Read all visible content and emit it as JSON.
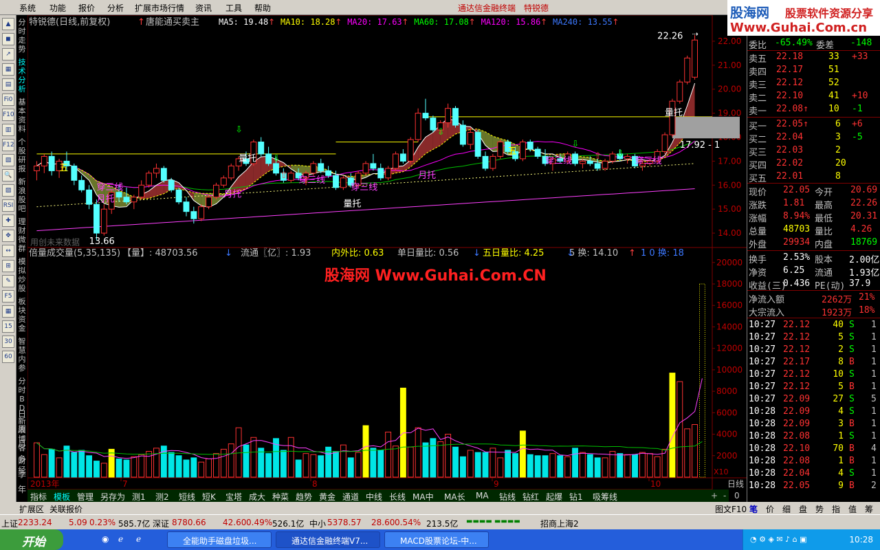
{
  "menu": {
    "items": [
      "系统",
      "功能",
      "报价",
      "分析",
      "扩展市场行情",
      "资讯",
      "工具",
      "帮助"
    ],
    "app_name": "通达信金融终端",
    "stock_name": "特锐德"
  },
  "logo": {
    "line1": "股海网",
    "line1b": "股票软件资源分享",
    "line2": "Www.Guhai.Com.cn"
  },
  "left_tabs": [
    "分时走势",
    "技术分析",
    "基本资料",
    "个股研报",
    "新浪股吧",
    "理财微群",
    "模拟炒股",
    "板块资金",
    "智慧内参",
    "分时BD",
    "新浪博客",
    "财经"
  ],
  "left_tabs_bottom": [
    "日",
    "周",
    "月",
    "多",
    "季",
    "年"
  ],
  "left_tools": [
    "▲",
    "◼",
    "↗",
    "▦",
    "▤",
    "Fi0",
    "F10",
    "▥",
    "F12",
    "▧",
    "🔍",
    "▨",
    "RSI",
    "✚",
    "✥",
    "↔",
    "⊞",
    "✎",
    "F5",
    "▦",
    "15",
    "30",
    "60"
  ],
  "chart": {
    "title": "特锐德(日线,前复权)",
    "indicator": "唐能通买卖主",
    "ma": [
      {
        "label": "MA5: 19.48",
        "color": "#ffffff"
      },
      {
        "label": "MA10: 18.28",
        "color": "#ffff00"
      },
      {
        "label": "MA20: 17.63",
        "color": "#ff00ff"
      },
      {
        "label": "MA60: 17.08",
        "color": "#00ff00"
      },
      {
        "label": "MA120: 15.86",
        "color": "#ff00ff"
      },
      {
        "label": "MA240: 13.55",
        "color": "#3c78ff"
      }
    ],
    "high_label": "22.26",
    "low_label": "13.66",
    "right_label": "17.92 - 1",
    "annotations": [
      "量托",
      "量托",
      "量托",
      "月托",
      "月托",
      "月托",
      "穿三线",
      "穿三线",
      "穿三线",
      "穿三线",
      "穿三线",
      "五",
      "五"
    ],
    "watermark_text": "用创未来数据",
    "year_label": "2013年",
    "months": [
      "7",
      "8",
      "9",
      "10"
    ],
    "period": "日线",
    "f10_label": "X10"
  },
  "chart_data": {
    "type": "candlestick",
    "price_axis": [
      22,
      21,
      20,
      19,
      18,
      17,
      16,
      15,
      14
    ],
    "ohlc": [
      {
        "o": 16.6,
        "h": 17.0,
        "l": 16.2,
        "c": 16.8
      },
      {
        "o": 16.8,
        "h": 17.3,
        "l": 16.5,
        "c": 17.2
      },
      {
        "o": 17.2,
        "h": 17.4,
        "l": 16.4,
        "c": 16.6
      },
      {
        "o": 16.6,
        "h": 17.1,
        "l": 16.3,
        "c": 17.0
      },
      {
        "o": 17.0,
        "h": 17.4,
        "l": 16.6,
        "c": 16.8
      },
      {
        "o": 16.8,
        "h": 16.9,
        "l": 16.0,
        "c": 16.2
      },
      {
        "o": 16.2,
        "h": 16.4,
        "l": 15.7,
        "c": 15.8
      },
      {
        "o": 15.8,
        "h": 16.0,
        "l": 15.0,
        "c": 15.2
      },
      {
        "o": 15.2,
        "h": 15.4,
        "l": 13.7,
        "c": 14.0
      },
      {
        "o": 14.0,
        "h": 15.2,
        "l": 13.9,
        "c": 15.0
      },
      {
        "o": 15.0,
        "h": 15.8,
        "l": 14.8,
        "c": 15.7
      },
      {
        "o": 15.7,
        "h": 16.0,
        "l": 15.3,
        "c": 15.5
      },
      {
        "o": 15.5,
        "h": 15.9,
        "l": 15.2,
        "c": 15.3
      },
      {
        "o": 15.3,
        "h": 15.6,
        "l": 15.0,
        "c": 15.5
      },
      {
        "o": 15.5,
        "h": 16.2,
        "l": 15.4,
        "c": 16.0
      },
      {
        "o": 16.0,
        "h": 16.6,
        "l": 15.9,
        "c": 16.5
      },
      {
        "o": 16.5,
        "h": 16.9,
        "l": 16.3,
        "c": 16.7
      },
      {
        "o": 16.7,
        "h": 16.8,
        "l": 16.1,
        "c": 16.2
      },
      {
        "o": 16.2,
        "h": 16.3,
        "l": 15.7,
        "c": 15.8
      },
      {
        "o": 15.8,
        "h": 15.9,
        "l": 15.2,
        "c": 15.3
      },
      {
        "o": 15.3,
        "h": 15.5,
        "l": 14.7,
        "c": 14.9
      },
      {
        "o": 14.9,
        "h": 15.1,
        "l": 14.4,
        "c": 14.6
      },
      {
        "o": 14.6,
        "h": 15.2,
        "l": 14.5,
        "c": 15.1
      },
      {
        "o": 15.1,
        "h": 15.6,
        "l": 15.0,
        "c": 15.5
      },
      {
        "o": 15.5,
        "h": 16.1,
        "l": 15.4,
        "c": 16.0
      },
      {
        "o": 16.0,
        "h": 16.4,
        "l": 15.9,
        "c": 16.3
      },
      {
        "o": 16.3,
        "h": 16.9,
        "l": 16.2,
        "c": 16.8
      },
      {
        "o": 16.8,
        "h": 17.2,
        "l": 16.6,
        "c": 17.1
      },
      {
        "o": 17.1,
        "h": 17.4,
        "l": 16.8,
        "c": 16.9
      },
      {
        "o": 16.9,
        "h": 17.9,
        "l": 16.8,
        "c": 17.8
      },
      {
        "o": 17.8,
        "h": 18.0,
        "l": 17.2,
        "c": 17.3
      },
      {
        "o": 17.3,
        "h": 17.6,
        "l": 16.8,
        "c": 16.9
      },
      {
        "o": 16.9,
        "h": 17.2,
        "l": 16.4,
        "c": 16.5
      },
      {
        "o": 16.5,
        "h": 16.7,
        "l": 16.1,
        "c": 16.2
      },
      {
        "o": 16.2,
        "h": 16.6,
        "l": 16.1,
        "c": 16.5
      },
      {
        "o": 16.5,
        "h": 16.7,
        "l": 16.2,
        "c": 16.3
      },
      {
        "o": 16.3,
        "h": 16.6,
        "l": 16.0,
        "c": 16.5
      },
      {
        "o": 16.5,
        "h": 17.0,
        "l": 16.4,
        "c": 16.9
      },
      {
        "o": 16.9,
        "h": 17.1,
        "l": 16.5,
        "c": 16.6
      },
      {
        "o": 16.6,
        "h": 16.8,
        "l": 16.3,
        "c": 16.4
      },
      {
        "o": 16.4,
        "h": 16.6,
        "l": 15.8,
        "c": 15.9
      },
      {
        "o": 15.9,
        "h": 16.4,
        "l": 15.8,
        "c": 16.3
      },
      {
        "o": 16.3,
        "h": 16.5,
        "l": 15.9,
        "c": 16.0
      },
      {
        "o": 16.0,
        "h": 16.6,
        "l": 15.9,
        "c": 16.5
      },
      {
        "o": 16.5,
        "h": 17.0,
        "l": 16.4,
        "c": 16.9
      },
      {
        "o": 16.9,
        "h": 17.3,
        "l": 16.6,
        "c": 16.7
      },
      {
        "o": 16.7,
        "h": 16.9,
        "l": 16.2,
        "c": 16.3
      },
      {
        "o": 16.3,
        "h": 16.8,
        "l": 16.2,
        "c": 16.7
      },
      {
        "o": 16.7,
        "h": 17.4,
        "l": 16.6,
        "c": 17.3
      },
      {
        "o": 17.3,
        "h": 17.5,
        "l": 16.9,
        "c": 17.0
      },
      {
        "o": 17.0,
        "h": 18.0,
        "l": 16.9,
        "c": 17.9
      },
      {
        "o": 17.9,
        "h": 19.2,
        "l": 17.8,
        "c": 19.0
      },
      {
        "o": 19.0,
        "h": 19.6,
        "l": 18.7,
        "c": 18.8
      },
      {
        "o": 18.8,
        "h": 18.9,
        "l": 18.2,
        "c": 18.3
      },
      {
        "o": 18.3,
        "h": 18.7,
        "l": 18.1,
        "c": 18.6
      },
      {
        "o": 18.6,
        "h": 19.4,
        "l": 18.4,
        "c": 19.2
      },
      {
        "o": 19.2,
        "h": 19.3,
        "l": 18.4,
        "c": 18.5
      },
      {
        "o": 18.5,
        "h": 18.7,
        "l": 17.6,
        "c": 17.7
      },
      {
        "o": 17.7,
        "h": 18.4,
        "l": 17.5,
        "c": 18.2
      },
      {
        "o": 18.2,
        "h": 18.3,
        "l": 17.1,
        "c": 17.2
      },
      {
        "o": 17.2,
        "h": 17.4,
        "l": 16.6,
        "c": 16.7
      },
      {
        "o": 16.7,
        "h": 17.3,
        "l": 16.6,
        "c": 17.2
      },
      {
        "o": 17.2,
        "h": 17.9,
        "l": 17.1,
        "c": 17.8
      },
      {
        "o": 17.8,
        "h": 17.9,
        "l": 17.3,
        "c": 17.4
      },
      {
        "o": 17.4,
        "h": 17.6,
        "l": 17.0,
        "c": 17.1
      },
      {
        "o": 17.1,
        "h": 17.9,
        "l": 17.0,
        "c": 17.8
      },
      {
        "o": 17.8,
        "h": 17.9,
        "l": 17.4,
        "c": 17.5
      },
      {
        "o": 17.5,
        "h": 17.6,
        "l": 17.1,
        "c": 17.2
      },
      {
        "o": 17.2,
        "h": 17.5,
        "l": 16.8,
        "c": 16.9
      },
      {
        "o": 16.9,
        "h": 17.2,
        "l": 16.6,
        "c": 17.1
      },
      {
        "o": 17.1,
        "h": 17.3,
        "l": 16.9,
        "c": 17.0
      },
      {
        "o": 17.0,
        "h": 17.4,
        "l": 16.9,
        "c": 17.3
      },
      {
        "o": 17.3,
        "h": 17.4,
        "l": 16.8,
        "c": 16.9
      },
      {
        "o": 16.9,
        "h": 17.1,
        "l": 16.7,
        "c": 17.0
      },
      {
        "o": 17.0,
        "h": 17.2,
        "l": 16.8,
        "c": 16.9
      },
      {
        "o": 16.9,
        "h": 17.1,
        "l": 16.6,
        "c": 16.7
      },
      {
        "o": 16.7,
        "h": 17.1,
        "l": 16.6,
        "c": 17.0
      },
      {
        "o": 17.0,
        "h": 17.4,
        "l": 16.9,
        "c": 17.3
      },
      {
        "o": 17.3,
        "h": 17.5,
        "l": 17.0,
        "c": 17.1
      },
      {
        "o": 17.1,
        "h": 17.3,
        "l": 16.9,
        "c": 17.2
      },
      {
        "o": 17.2,
        "h": 17.3,
        "l": 16.7,
        "c": 16.8
      },
      {
        "o": 16.8,
        "h": 17.0,
        "l": 16.6,
        "c": 16.9
      },
      {
        "o": 16.9,
        "h": 17.1,
        "l": 16.8,
        "c": 17.0
      },
      {
        "o": 17.0,
        "h": 17.5,
        "l": 16.9,
        "c": 17.4
      },
      {
        "o": 17.4,
        "h": 18.2,
        "l": 17.3,
        "c": 18.1
      },
      {
        "o": 18.1,
        "h": 19.6,
        "l": 18.0,
        "c": 19.5
      },
      {
        "o": 19.5,
        "h": 20.4,
        "l": 19.4,
        "c": 20.3
      },
      {
        "o": 20.3,
        "h": 21.4,
        "l": 20.2,
        "c": 21.3
      },
      {
        "o": 20.5,
        "h": 22.26,
        "l": 20.4,
        "c": 22.05
      }
    ],
    "volume_axis": [
      20000,
      18000,
      16000,
      14000,
      12000,
      10000,
      8000,
      6000,
      4000,
      2000
    ],
    "volume": [
      3200,
      2100,
      2600,
      1800,
      2900,
      2300,
      2500,
      2000,
      1500,
      1300,
      2600,
      1700,
      1600,
      1900,
      2100,
      2400,
      2700,
      2900,
      2300,
      2000,
      1600,
      1800,
      1400,
      1700,
      2200,
      2600,
      3100,
      4600,
      3000,
      3700,
      2700,
      2200,
      3600,
      2500,
      3700,
      1600,
      2200,
      2100,
      2000,
      2800,
      2400,
      3000,
      1800,
      2300,
      4800,
      2700,
      2500,
      4200,
      2900,
      8300,
      2800,
      4600,
      3200,
      3600,
      3300,
      4000,
      2800,
      1900,
      2500,
      2300,
      2300,
      2700,
      1800,
      2500,
      2200,
      4300,
      2100,
      2000,
      2000,
      2200,
      2000,
      1900,
      2700,
      2300,
      2100,
      1800,
      1800,
      2400,
      2200,
      2100,
      2100,
      2300,
      2200,
      1900,
      2600,
      9700,
      8900,
      4500,
      4900,
      18000
    ]
  },
  "volume_header": {
    "title": "倍量成交量(5,35,135)",
    "vol": "【量】: 48703.56",
    "flow": "流通〖亿〗: 1.93",
    "ratio": "内外比: 0.63",
    "single": "单日量比: 0.56",
    "five": "五日量比: 4.25",
    "turn": "5 换: 14.10",
    "turn10": "1 0 换: 18"
  },
  "watermark": "股海网 Www.Guhai.Com.CN",
  "order_book": {
    "weibi_label": "委比",
    "weibi": "-65.49%",
    "weicha_label": "委差",
    "weicha": "-148",
    "sell": [
      {
        "label": "卖五",
        "price": "22.18",
        "vol": "33",
        "chg": "+33"
      },
      {
        "label": "卖四",
        "price": "22.17",
        "vol": "51",
        "chg": ""
      },
      {
        "label": "卖三",
        "price": "22.12",
        "vol": "52",
        "chg": ""
      },
      {
        "label": "卖二",
        "price": "22.10",
        "vol": "41",
        "chg": "+10"
      },
      {
        "label": "卖一",
        "price": "22.08↑",
        "vol": "10",
        "chg": "-1"
      }
    ],
    "buy": [
      {
        "label": "买一",
        "price": "22.05↑",
        "vol": "6",
        "chg": "+6"
      },
      {
        "label": "买二",
        "price": "22.04",
        "vol": "3",
        "chg": "-5"
      },
      {
        "label": "买三",
        "price": "22.03",
        "vol": "2",
        "chg": ""
      },
      {
        "label": "买四",
        "price": "22.02",
        "vol": "20",
        "chg": ""
      },
      {
        "label": "买五",
        "price": "22.01",
        "vol": "8",
        "chg": ""
      }
    ]
  },
  "quote": [
    {
      "l1": "现价",
      "v1": "22.05",
      "l2": "今开",
      "v2": "20.69"
    },
    {
      "l1": "涨跌",
      "v1": "1.81",
      "l2": "最高",
      "v2": "22.26"
    },
    {
      "l1": "涨幅",
      "v1": "8.94%",
      "l2": "最低",
      "v2": "20.31"
    },
    {
      "l1": "总量",
      "v1": "48703",
      "l2": "量比",
      "v2": "4.26"
    },
    {
      "l1": "外盘",
      "v1": "29934",
      "l2": "内盘",
      "v2": "18769"
    }
  ],
  "stats": [
    {
      "l1": "换手",
      "v1": "2.53%",
      "l2": "股本",
      "v2": "2.00亿"
    },
    {
      "l1": "净资",
      "v1": "6.25",
      "l2": "流通",
      "v2": "1.93亿"
    },
    {
      "l1": "收益(三)",
      "v1": "0.436",
      "l2": "PE(动)",
      "v2": "37.9"
    }
  ],
  "flows": [
    {
      "label": "净流入额",
      "value": "2262万",
      "pct": "21%"
    },
    {
      "label": "大宗流入",
      "value": "1923万",
      "pct": "18%"
    }
  ],
  "ticks": [
    {
      "t": "10:27",
      "p": "22.12",
      "v": "40",
      "s": "S",
      "n": "1"
    },
    {
      "t": "10:27",
      "p": "22.12",
      "v": "5",
      "s": "S",
      "n": "1"
    },
    {
      "t": "10:27",
      "p": "22.12",
      "v": "2",
      "s": "S",
      "n": "1"
    },
    {
      "t": "10:27",
      "p": "22.17",
      "v": "8",
      "s": "B",
      "n": "1"
    },
    {
      "t": "10:27",
      "p": "22.12",
      "v": "10",
      "s": "S",
      "n": "1"
    },
    {
      "t": "10:27",
      "p": "22.12",
      "v": "5",
      "s": "B",
      "n": "1"
    },
    {
      "t": "10:27",
      "p": "22.09",
      "v": "27",
      "s": "S",
      "n": "5"
    },
    {
      "t": "10:28",
      "p": "22.09",
      "v": "4",
      "s": "S",
      "n": "1"
    },
    {
      "t": "10:28",
      "p": "22.09",
      "v": "3",
      "s": "B",
      "n": "1"
    },
    {
      "t": "10:28",
      "p": "22.08",
      "v": "1",
      "s": "S",
      "n": "1"
    },
    {
      "t": "10:28",
      "p": "22.10",
      "v": "70",
      "s": "B",
      "n": "4"
    },
    {
      "t": "10:28",
      "p": "22.08",
      "v": "1",
      "s": "B",
      "n": "1"
    },
    {
      "t": "10:28",
      "p": "22.04",
      "v": "4",
      "s": "S",
      "n": "1"
    },
    {
      "t": "10:28",
      "p": "22.05",
      "v": "9",
      "s": "B",
      "n": "2"
    }
  ],
  "toolbar": [
    "指标",
    "模板",
    "管理",
    "另存为",
    "测1",
    "测2",
    "短线",
    "短K",
    "宝塔",
    "成大",
    "种菜",
    "趋势",
    "黄金",
    "通道",
    "中线",
    "长线",
    "MA中",
    "MA长",
    "MA",
    "钻线",
    "钻红",
    "起爆",
    "钻1",
    "吸筹线"
  ],
  "ext_bar": [
    "扩展区",
    "关联报价"
  ],
  "period_nav": [
    "日线",
    "+",
    "-",
    "0",
    "图文F10"
  ],
  "right_tabs": [
    "笔",
    "价",
    "细",
    "盘",
    "势",
    "指",
    "值",
    "筹"
  ],
  "status": {
    "sh_label": "上证",
    "sh_val": "2233.24",
    "sh_chg": "5.09",
    "sh_pct": "0.23%",
    "sh_amt": "585.7亿",
    "sz_label": "深证",
    "sz_val": "8780.66",
    "sz_chg": "42.60",
    "sz_pct": "0.49%",
    "sz_amt": "526.1亿",
    "zx_label": "中小",
    "zx_val": "5378.57",
    "zx_chg": "28.60",
    "zx_pct": "0.54%",
    "zx_amt": "213.5亿",
    "broker": "招商上海2"
  },
  "taskbar": {
    "start": "开始",
    "tasks": [
      "全能助手磁盘垃圾...",
      "通达信金融终端V7...",
      "MACD股票论坛-中..."
    ],
    "clock": "10:28"
  }
}
